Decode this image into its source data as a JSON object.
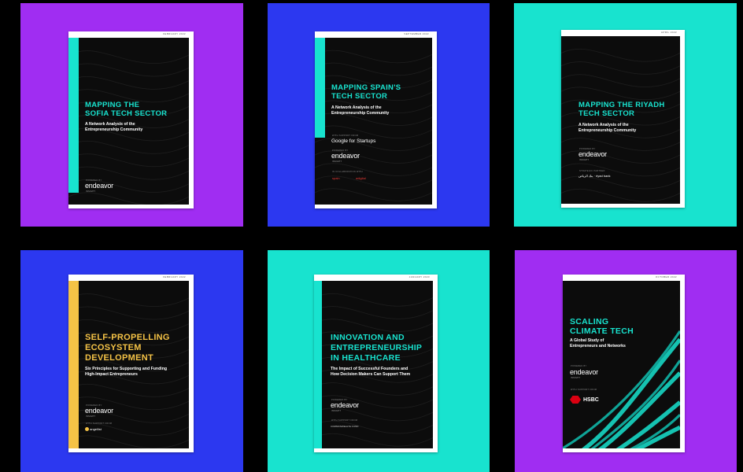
{
  "colors": {
    "purple": "#a02df2",
    "blue": "#2c38f0",
    "teal": "#18e3cf",
    "cover_bg": "#0c0c0c",
    "yellow": "#f5c346"
  },
  "covers": [
    {
      "date": "FEBRUARY 2022",
      "title_line1": "MAPPING THE",
      "title_line2": "SOFIA TECH SECTOR",
      "subtitle_line1": "A Network Analysis of the",
      "subtitle_line2": "Entrepreneurship Community",
      "powered_label": "POWERED BY",
      "logo": "endeavor",
      "logo_sub": "INSIGHT"
    },
    {
      "date": "SEPTEMBER 2022",
      "title_line1": "MAPPING SPAIN'S",
      "title_line2": "TECH SECTOR",
      "subtitle_line1": "A Network Analysis of the",
      "subtitle_line2": "Entrepreneurship Community",
      "support_label": "WITH SUPPORT FROM",
      "partner": "Google for Startups",
      "powered_label": "POWERED BY",
      "logo": "endeavor",
      "logo_sub": "INSIGHT",
      "collab_label": "IN COLLABORATION WITH",
      "collab1": "spain",
      "collab2": "adigital"
    },
    {
      "date": "APRIL 2022",
      "title_line1": "MAPPING THE RIYADH",
      "title_line2": "TECH SECTOR",
      "subtitle_line1": "A Network Analysis of the",
      "subtitle_line2": "Entrepreneurship Community",
      "powered_label": "POWERED BY",
      "logo": "endeavor",
      "logo_sub": "INSIGHT",
      "partner_label": "STRATEGIC PARTNER",
      "partner_logo": "بنك الرياض · riyad bank"
    },
    {
      "date": "FEBRUARY 2022",
      "title_line1": "SELF-PROPELLING",
      "title_line2": "ECOSYSTEM",
      "title_line3": "DEVELOPMENT",
      "subtitle_line1": "Six Principles for Supporting and Funding",
      "subtitle_line2": "High-Impact Entrepreneurs",
      "powered_label": "POWERED BY",
      "logo": "endeavor",
      "logo_sub": "INSIGHT",
      "support_label": "WITH SUPPORT FROM",
      "partner": "angellist"
    },
    {
      "date": "JANUARY 2023",
      "title_line1": "INNOVATION AND",
      "title_line2": "ENTREPRENEURSHIP",
      "title_line3": "IN HEALTHCARE",
      "subtitle_line1": "The Impact of Successful Founders and",
      "subtitle_line2": "How Decision Makers Can Support Them",
      "powered_label": "POWERED BY",
      "logo": "endeavor",
      "logo_sub": "INSIGHT",
      "support_label": "WITH SUPPORT FROM",
      "partner": "COMMONWEALTH FUND"
    },
    {
      "date": "OCTOBER 2022",
      "title_line1": "SCALING",
      "title_line2": "CLIMATE TECH",
      "subtitle_line1": "A Global Study of",
      "subtitle_line2": "Entrepreneurs and Networks",
      "powered_label": "POWERED BY",
      "logo": "endeavor",
      "logo_sub": "INSIGHT",
      "support_label": "WITH SUPPORT FROM",
      "partner": "HSBC"
    }
  ]
}
